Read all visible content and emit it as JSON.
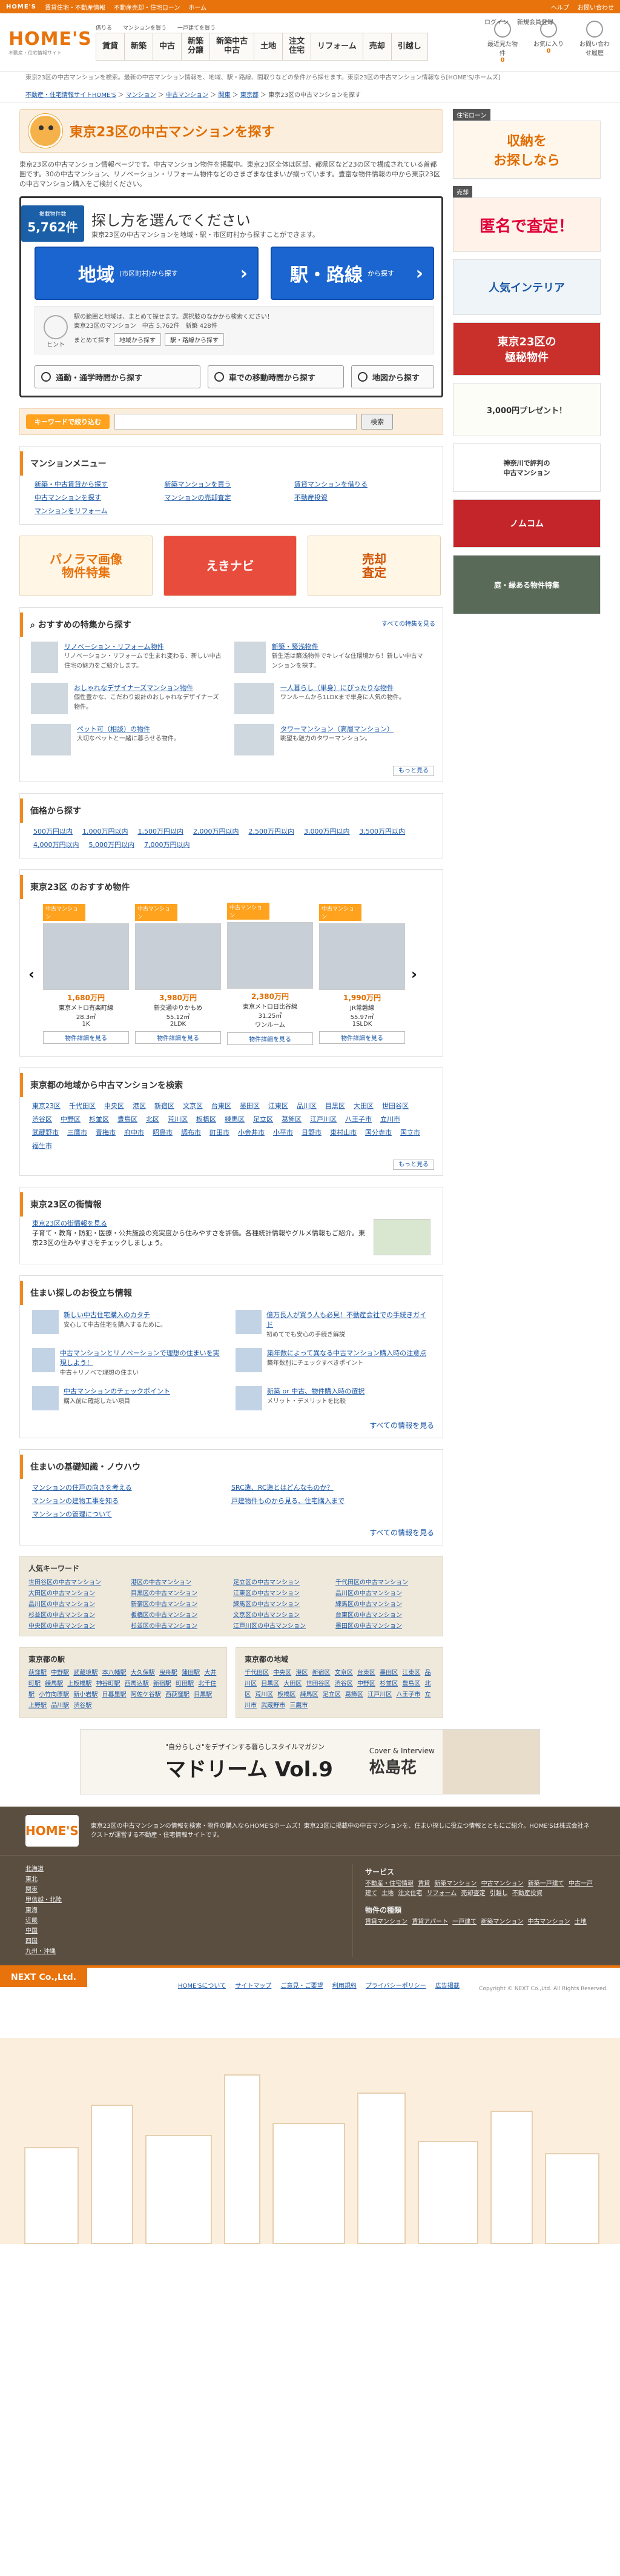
{
  "topstrip": {
    "brand": "HOME'S",
    "links": [
      "賃貸住宅・不動産情報",
      "不動産売却・住宅ローン",
      "ホーム"
    ],
    "right": [
      "ヘルプ",
      "お問い合わせ"
    ]
  },
  "header": {
    "logo": "HOME'S",
    "logo_sub": "不動産・住宅情報サイト",
    "gnav_top": [
      "借りる",
      "マンションを買う",
      "一戸建てを買う"
    ],
    "gnav": [
      "賃貸",
      "新築",
      "中古",
      "新築\n分譲",
      "新築中古\n中古",
      "土地",
      "注文\n住宅",
      "リフォーム",
      "売却",
      "引越し"
    ],
    "login": [
      "ログイン",
      "新規会員登録"
    ],
    "icons": [
      {
        "label": "最近見た物件",
        "count": "0"
      },
      {
        "label": "お気に入り",
        "count": "0"
      },
      {
        "label": "お問い合わせ履歴",
        "count": ""
      }
    ]
  },
  "subbar": "東京23区の中古マンションを検索。最新の中古マンション情報を、地域、駅・路線、間取りなどの条件から探せます。東京23区の中古マンション情報なら[HOME'S/ホームズ]",
  "crumbs": [
    "不動産・住宅情報サイトHOME'S",
    "マンション",
    "中古マンション",
    "関東",
    "東京都",
    "東京23区の中古マンションを探す"
  ],
  "page": {
    "title": "東京23区の中古マンションを探す",
    "intro": "東京23区の中古マンション情報ページです。中古マンション物件を掲載中。東京23区全体は区部、都県区など23の区で構成されている首都圏です。30の中古マンション、リノベーション・リフォーム物件などのさまざまな住まいが揃っています。豊富な物件情報の中から東京23区の中古マンション購入をご検討ください。"
  },
  "search": {
    "count_label": "掲載物件数",
    "count": "5,762件",
    "heading": "探し方を選んでください",
    "sub": "東京23区の中古マンションを地域・駅・市区町村から探すことができます。",
    "area_btn": "地域",
    "area_btn_sub": "(市区町村)から探す",
    "station_btn": "駅・路線",
    "station_btn_sub": "から探す",
    "hint_label": "ヒント",
    "hint_text": "駅の範囲と地域は、まとめて探せます。選択肢のなかから検索ください！",
    "hint_count": "東京23区のマンション　中古 5,762件　新築 428件",
    "hint_action": "まとめて探す",
    "hint_btn1": "地域から探す",
    "hint_btn2": "駅・路線から探す",
    "row": [
      "通勤・通学時間から探す",
      "車での移動時間から探す",
      "地図から探す"
    ]
  },
  "keyword": {
    "label": "キーワードで絞り込む",
    "placeholder": "",
    "button": "検索"
  },
  "menu": {
    "title": "マンションメニュー",
    "items": [
      "新築・中古賃貸から探す",
      "新築マンションを買う",
      "賃貸マンションを借りる",
      "中古マンションを探す",
      "マンションの売却査定",
      "不動産投資",
      "マンションをリフォーム"
    ]
  },
  "banners3": [
    "パノラマ画像\n物件特集",
    "えきナビ",
    "売却\n査定"
  ],
  "featured": {
    "title": "おすすめの特集から探す",
    "more": "すべての特集を見る",
    "items": [
      {
        "title": "リノベーション・リフォーム物件",
        "desc": "リノベーション・リフォームで生まれ変わる、新しい中古住宅の魅力をご紹介します。"
      },
      {
        "title": "新築・築浅物件",
        "desc": "新生活は築浅物件でキレイな住環境から！新しい中古マンションを探す。"
      },
      {
        "title": "おしゃれなデザイナーズマンション物件",
        "desc": "個性豊かな、こだわり設計のおしゃれなデザイナーズ物件。"
      },
      {
        "title": "一人暮らし（単身）にぴったりな物件",
        "desc": "ワンルームから1LDKまで単身に人気の物件。"
      },
      {
        "title": "ペット可（相談）の物件",
        "desc": "大切なペットと一緒に暮らせる物件。"
      },
      {
        "title": "タワーマンション（高層マンション）",
        "desc": "眺望も魅力のタワーマンション。"
      }
    ],
    "more_btn": "もっと見る"
  },
  "prices": {
    "title": "価格から探す",
    "items": [
      "500万円以内",
      "1,000万円以内",
      "1,500万円以内",
      "2,000万円以内",
      "2,500万円以内",
      "3,000万円以内",
      "3,500万円以内",
      "4,000万円以内",
      "5,000万円以内",
      "7,000万円以内"
    ]
  },
  "recs": {
    "title": "東京23区 のおすすめ物件",
    "items": [
      {
        "tag": "中古マンション",
        "price": "1,680万円",
        "loc": "東京メトロ有楽町線",
        "sub": "28.3㎡",
        "sub2": "1K",
        "btn": "物件詳細を見る"
      },
      {
        "tag": "中古マンション",
        "price": "3,980万円",
        "loc": "新交通ゆりかもめ",
        "sub": "55.12㎡",
        "sub2": "2LDK",
        "btn": "物件詳細を見る"
      },
      {
        "tag": "中古マンション",
        "price": "2,380万円",
        "loc": "東京メトロ日比谷線",
        "sub": "31.25㎡",
        "sub2": "ワンルーム",
        "btn": "物件詳細を見る"
      },
      {
        "tag": "中古マンション",
        "price": "1,990万円",
        "loc": "JR常磐線",
        "sub": "55.97㎡",
        "sub2": "1SLDK",
        "btn": "物件詳細を見る"
      }
    ]
  },
  "areas": {
    "title": "東京都の地域から中古マンションを検索",
    "items": [
      "東京23区",
      "千代田区",
      "中央区",
      "港区",
      "新宿区",
      "文京区",
      "台東区",
      "墨田区",
      "江東区",
      "品川区",
      "目黒区",
      "大田区",
      "世田谷区",
      "渋谷区",
      "中野区",
      "杉並区",
      "豊島区",
      "北区",
      "荒川区",
      "板橋区",
      "練馬区",
      "足立区",
      "葛飾区",
      "江戸川区",
      "八王子市",
      "立川市",
      "武蔵野市",
      "三鷹市",
      "青梅市",
      "府中市",
      "昭島市",
      "調布市",
      "町田市",
      "小金井市",
      "小平市",
      "日野市",
      "東村山市",
      "国分寺市",
      "国立市",
      "福生市"
    ],
    "more": "もっと見る"
  },
  "info": {
    "title": "東京23区の街情報",
    "link": "東京23区の街情報を見る",
    "text": "子育て・教育・防犯・医療・公共施設の充実度から住みやすさを評価。各種統計情報やグルメ情報もご紹介。東京23区の住みやすさをチェックしましょう。"
  },
  "posts": {
    "title": "住まい探しのお役立ち情報",
    "items": [
      {
        "title": "新しい中古住宅購入のカタチ",
        "desc": "安心して中古住宅を購入するために。"
      },
      {
        "title": "億万長人が買う人も必見！不動産会社での手続きガイド",
        "desc": "初めてでも安心の手続き解説"
      },
      {
        "title": "中古マンションとリノベーションで理想の住まいを実現しよう！",
        "desc": "中古＋リノベで理想の住まい"
      },
      {
        "title": "築年数によって異なる中古マンション購入時の注意点",
        "desc": "築年数別にチェックすべきポイント"
      },
      {
        "title": "中古マンションのチェックポイント",
        "desc": "購入前に確認したい項目"
      },
      {
        "title": "新築 or 中古、物件購入時の選択",
        "desc": "メリット・デメリットを比較"
      }
    ],
    "more": "すべての情報を見る"
  },
  "basics": {
    "title": "住まいの基礎知識・ノウハウ",
    "items": [
      "マンションの住戸の向きを考える",
      "SRC造、RC造とはどんなものか？",
      "マンションの建物工事を知る",
      "戸建物件ものから見る、住宅購入まで",
      "マンションの管理について"
    ],
    "more": "すべての情報を見る"
  },
  "keywords": {
    "title": "人気キーワード",
    "items": [
      "世田谷区の中古マンション",
      "港区の中古マンション",
      "足立区の中古マンション",
      "千代田区の中古マンション",
      "大田区の中古マンション",
      "目黒区の中古マンション",
      "江東区の中古マンション",
      "品川区の中古マンション",
      "品川区の中古マンション",
      "新宿区の中古マンション",
      "練馬区の中古マンション",
      "練馬区の中古マンション",
      "杉並区の中古マンション",
      "板橋区の中古マンション",
      "文京区の中古マンション",
      "台東区の中古マンション",
      "中央区の中古マンション",
      "杉並区の中古マンション",
      "江戸川区の中古マンション",
      "墨田区の中古マンション"
    ]
  },
  "stations": {
    "title": "東京都の駅",
    "items": [
      "荻窪駅",
      "中野駅",
      "武蔵境駅",
      "本八幡駅",
      "大久保駅",
      "曳舟駅",
      "蒲田駅",
      "大井町駅",
      "練馬駅",
      "上板橋駅",
      "神谷町駅",
      "西馬込駅",
      "新宿駅",
      "町田駅",
      "北千住駅",
      "小竹向原駅",
      "新小岩駅",
      "日暮里駅",
      "阿佐ケ谷駅",
      "西荻窪駅",
      "目黒駅",
      "上野駅",
      "品川駅",
      "渋谷駅"
    ]
  },
  "regions": {
    "title": "東京都の地域",
    "items": [
      "千代田区",
      "中央区",
      "港区",
      "新宿区",
      "文京区",
      "台東区",
      "墨田区",
      "江東区",
      "品川区",
      "目黒区",
      "大田区",
      "世田谷区",
      "渋谷区",
      "中野区",
      "杉並区",
      "豊島区",
      "北区",
      "荒川区",
      "板橋区",
      "練馬区",
      "足立区",
      "葛飾区",
      "江戸川区",
      "八王子市",
      "立川市",
      "武蔵野市",
      "三鷹市"
    ]
  },
  "side": {
    "tag1": "住宅ローン",
    "b1": "収納を\nお探しなら",
    "tag2": "売却",
    "b2": "匿名で査定！",
    "b3": "人気インテリア",
    "b4": "東京23区の\n極秘物件",
    "b5": "3,000円プレゼント！",
    "b6": "神奈川で評判の\n中古マンション",
    "b7": "ノムコム",
    "b8": "庭・緑ある物件特集"
  },
  "magazine": {
    "kicker": "\"自分らしさ\"をデザインする暮らしスタイルマガジン",
    "title": "マドリーム Vol.9",
    "guest_label": "Cover & Interview",
    "guest": "松島花"
  },
  "footer": {
    "logo": "HOME'S",
    "desc": "東京23区の中古マンションの情報を検索・物件の購入ならHOME'Sホームズ！東京23区に掲載中の中古マンションを、住まい探しに役立つ情報とともにご紹介。HOME'Sは株式会社ネクストが運営する不動産・住宅情報サイトです。",
    "rows": [
      "北海道",
      "東北",
      "関東",
      "甲信越・北陸",
      "東海",
      "近畿",
      "中国",
      "四国",
      "九州・沖縄"
    ],
    "services_title": "サービス",
    "services": [
      "不動産・住宅情報",
      "賃貸",
      "新築マンション",
      "中古マンション",
      "新築一戸建て",
      "中古一戸建て",
      "土地",
      "注文住宅",
      "リフォーム",
      "売却査定",
      "引越し",
      "不動産投資"
    ],
    "types_title": "物件の種類",
    "types": [
      "賃貸マンション",
      "賃貸アパート",
      "一戸建て",
      "新築マンション",
      "中古マンション",
      "土地"
    ]
  },
  "bottom": {
    "company": "NEXT Co.,Ltd.",
    "links": [
      "HOME'Sについて",
      "サイトマップ",
      "ご意見・ご要望",
      "利用規約",
      "プライバシーポリシー",
      "広告掲載"
    ],
    "copy": "Copyright © NEXT Co.,Ltd. All Rights Reserved."
  }
}
